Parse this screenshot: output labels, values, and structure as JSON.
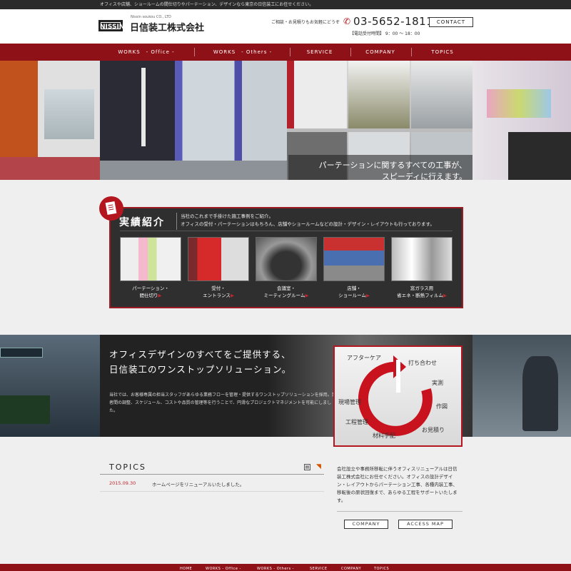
{
  "topbar": {
    "text": "オフィスや店舗、ショールームの間仕切りやパーテーション、デザインなら東京の日信装工にお任せください。"
  },
  "header": {
    "logo_mark": "NISSIN",
    "logo_sub": "Nissin soukou CO., LTD",
    "company_name": "日信装工株式会社",
    "consult_text": "ご相談・お見積りもお気軽にどうぞ",
    "phone": "03-5652-1811",
    "hours": "【電話受付時間】 9：00 ～ 18：00",
    "contact_label": "CONTACT"
  },
  "nav": {
    "items": [
      {
        "label": "WORKS　- Office -"
      },
      {
        "label": "WORKS　- Others -"
      },
      {
        "label": "SERVICE"
      },
      {
        "label": "COMPANY"
      },
      {
        "label": "TOPICS"
      }
    ]
  },
  "hero": {
    "caption_line1": "パーテーションに関するすべての工事が、",
    "caption_line2": "スピーディに行えます。"
  },
  "works": {
    "title": "実績紹介",
    "desc_line1": "当社のこれまで手掛けた施工事例をご紹介。",
    "desc_line2": "オフィスの受付・パーテーションはもちろん、店舗やショールームなどの設計・デザイン・レイアウトも行っております。",
    "items": [
      {
        "line1": "パーテーション・",
        "line2": "間仕切り"
      },
      {
        "line1": "受付・",
        "line2": "エントランス"
      },
      {
        "line1": "会議室・",
        "line2": "ミーティングルーム"
      },
      {
        "line1": "店舗・",
        "line2": "ショールーム"
      },
      {
        "line1": "窓ガラス用",
        "line2": "省エネ・断熱フィルム"
      }
    ],
    "arrow": "▶"
  },
  "solution": {
    "title_line1": "オフィスデザインのすべてをご提供する、",
    "title_line2": "日信装工のワンストップソリューション。",
    "desc": "当社では、お客様専属の担当スタッフがあらゆる業務フローを管理・提供するワンストップソリューションを採用。業者間の調整、スケジュール、コストや品質の管理等を行うことで、円滑なプロジェクトマネジメントを可能にしました。",
    "cycle": [
      "アフターケア",
      "打ち合わせ",
      "実測",
      "作図",
      "お見積り",
      "材料手配",
      "工程管理",
      "現場管理"
    ]
  },
  "topics": {
    "title": "TOPICS",
    "rss": "◥",
    "items": [
      {
        "date": "2015.09.30",
        "text": "ホームページをリニューアルいたしました。"
      }
    ]
  },
  "about": {
    "text": "会社設立や事務所移転に伴うオフィスリニューアルは日信装工株式会社にお任せください。オフィスの設計デザイン・レイアウトからパーテーション工事、各種内装工事、移転後の原状回復まで、あらゆる工程をサポートいたします。",
    "company_btn": "COMPANY",
    "access_btn": "ACCESS MAP"
  },
  "footer": {
    "items": [
      "HOME",
      "WORKS - Office -",
      "WORKS - Others -",
      "SERVICE",
      "COMPANY",
      "TOPICS"
    ]
  },
  "colors": {
    "brand_red": "#8e1117",
    "accent_red": "#b4161f"
  }
}
